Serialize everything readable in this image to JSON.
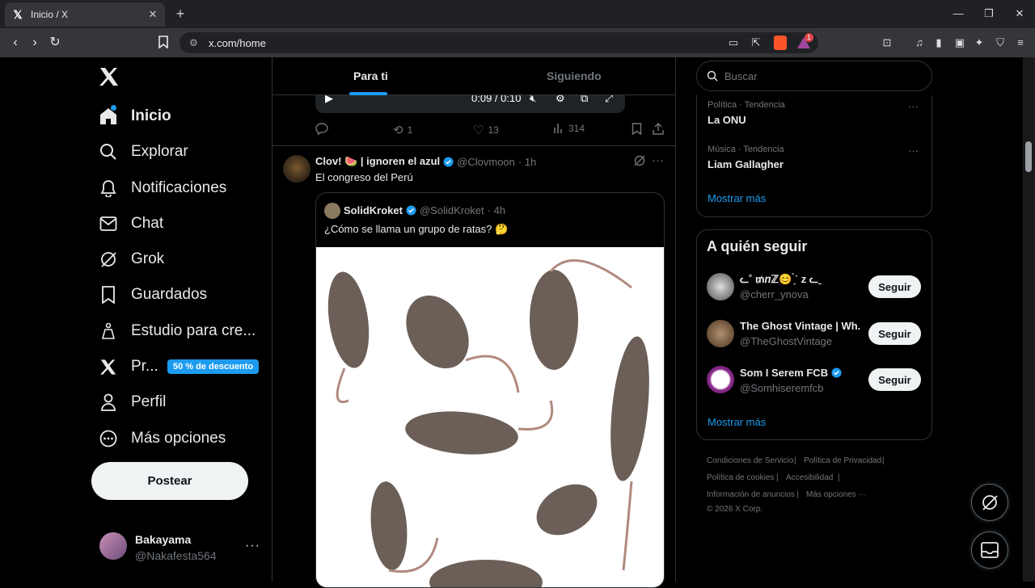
{
  "browser": {
    "tab_title": "Inicio / X",
    "url": "x.com/home",
    "badge_count": "1"
  },
  "nav": {
    "items": [
      {
        "label": "Inicio",
        "icon": "home-icon"
      },
      {
        "label": "Explorar",
        "icon": "search-icon"
      },
      {
        "label": "Notificaciones",
        "icon": "bell-icon"
      },
      {
        "label": "Chat",
        "icon": "mail-icon"
      },
      {
        "label": "Grok",
        "icon": "grok-icon"
      },
      {
        "label": "Guardados",
        "icon": "bookmark-icon"
      },
      {
        "label": "Estudio para cre...",
        "icon": "creator-studio-icon"
      },
      {
        "label": "Pr...",
        "icon": "x-premium-icon"
      },
      {
        "label": "Perfil",
        "icon": "person-icon"
      },
      {
        "label": "Más opciones",
        "icon": "more-circle-icon"
      }
    ],
    "promo_badge": "50 % de descuento",
    "post_button": "Postear"
  },
  "account": {
    "name": "Bakayama",
    "handle": "@Nakafesta564"
  },
  "feed": {
    "tabs": [
      "Para ti",
      "Siguiendo"
    ],
    "active_tab": "Para ti",
    "player": {
      "time": "0:09 / 0:10"
    },
    "prev_actions": {
      "reposts": "1",
      "likes": "13",
      "views": "314"
    },
    "post": {
      "author": "Clov! 🍉 | ignoren el azul",
      "handle": "@Clovmoon",
      "time": "· 1h",
      "text": "El congreso del Perú",
      "quote": {
        "author": "SolidKroket",
        "handle": "@SolidKroket",
        "time": "· 4h",
        "text": "¿Cómo se llama un grupo de ratas? 🤔"
      }
    }
  },
  "sidebar": {
    "search_placeholder": "Buscar",
    "trends": [
      {
        "meta": "Política · Tendencia",
        "title": "La ONU"
      },
      {
        "meta": "Música · Tendencia",
        "title": "Liam Gallagher"
      }
    ],
    "show_more": "Mostrar más",
    "who_to_follow": {
      "title": "A quién seguir",
      "users": [
        {
          "name": "ᓚ˚ ₥ⴖℤ😊 ̗̀ˋ z ᓚ ͟",
          "handle": "@cherr_ynova",
          "button": "Seguir"
        },
        {
          "name": "The Ghost Vintage | Wh...",
          "handle": "@TheGhostVintage",
          "button": "Seguir"
        },
        {
          "name": "Som I Serem FCB",
          "handle": "@Somhiseremfcb",
          "button": "Seguir"
        }
      ],
      "show_more": "Mostrar más"
    },
    "footer": {
      "links": [
        "Condiciones de Servicio",
        "Política de Privacidad",
        "Política de cookies",
        "Accesibilidad",
        "Información de anuncios",
        "Más opciones ···"
      ],
      "copyright": "© 2026 X Corp."
    }
  },
  "colors": {
    "accent": "#1d9bf0",
    "background": "#000000",
    "border": "#2f3336"
  }
}
